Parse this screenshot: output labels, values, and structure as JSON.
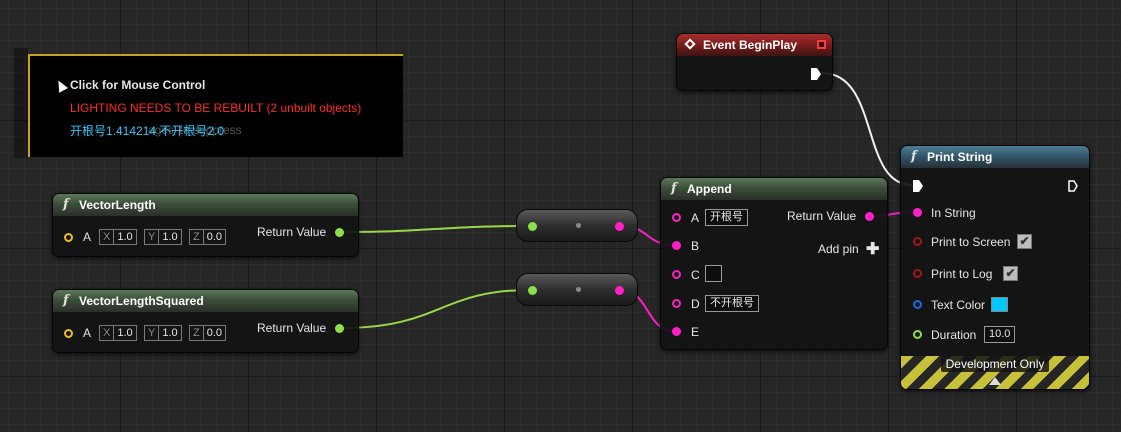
{
  "overlay": {
    "click_text": "Click for Mouse Control",
    "lighting_warning": "LIGHTING NEEDS TO BE REBUILT (2 unbuilt objects)",
    "ghost_text": "ages' to suppress",
    "print_output": "开根号1.414214  不开根号2.0",
    "warning_color": "#ff2a2a",
    "print_color": "#30c8ff"
  },
  "event_begin_play": {
    "title": "Event BeginPlay"
  },
  "vector_length": {
    "title": "VectorLength",
    "input_label": "A",
    "x_label": "X",
    "x_value": "1.0",
    "y_label": "Y",
    "y_value": "1.0",
    "z_label": "Z",
    "z_value": "0.0",
    "output_label": "Return Value"
  },
  "vector_length_squared": {
    "title": "VectorLengthSquared",
    "input_label": "A",
    "x_label": "X",
    "x_value": "1.0",
    "y_label": "Y",
    "y_value": "1.0",
    "z_label": "Z",
    "z_value": "0.0",
    "output_label": "Return Value"
  },
  "append": {
    "title": "Append",
    "pin_a_label": "A",
    "pin_a_value": "开根号",
    "pin_b_label": "B",
    "pin_c_label": "C",
    "pin_c_value": "",
    "pin_d_label": "D",
    "pin_d_value": "不开根号",
    "pin_e_label": "E",
    "output_label": "Return Value",
    "add_pin_label": "Add pin",
    "add_pin_glyph": "✚"
  },
  "print_string": {
    "title": "Print String",
    "in_string_label": "In String",
    "print_to_screen_label": "Print to Screen",
    "print_to_screen_checked": "✔",
    "print_to_log_label": "Print to Log",
    "print_to_log_checked": "✔",
    "text_color_label": "Text Color",
    "text_color_value": "#00c8ff",
    "duration_label": "Duration",
    "duration_value": "10.0",
    "development_only_label": "Development Only"
  },
  "icons": {
    "function_glyph": "f",
    "node_header_color_pure": "#3b4e39",
    "node_header_color_callable": "#34586b",
    "node_header_color_event": "#7a1c1c"
  }
}
